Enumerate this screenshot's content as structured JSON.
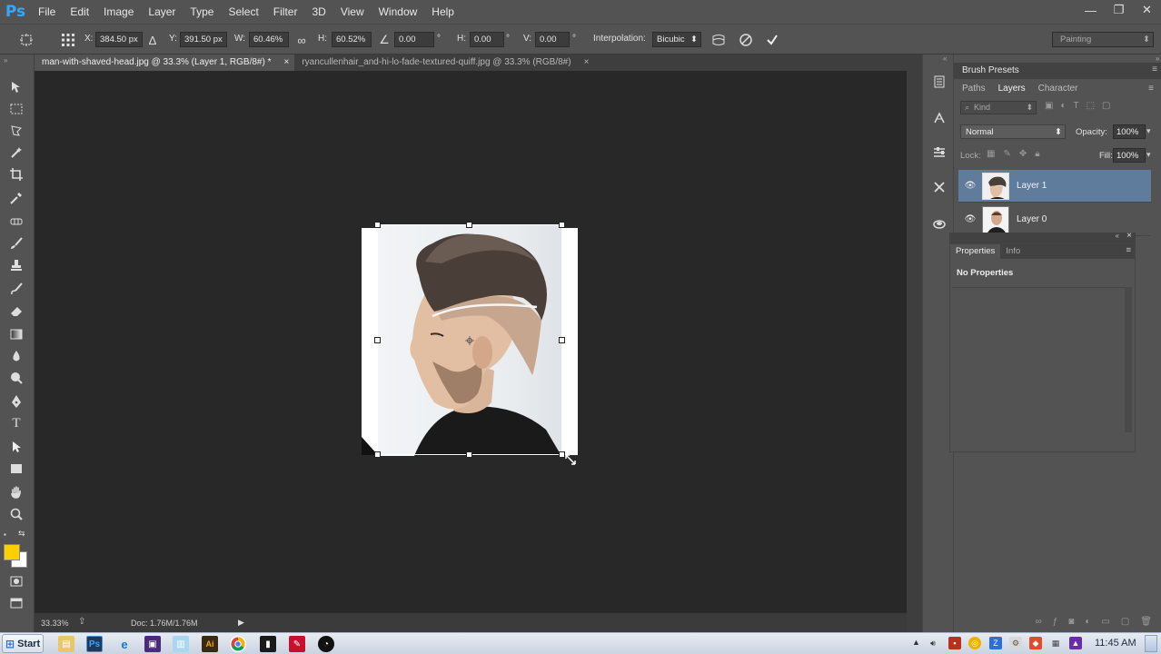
{
  "app": {
    "logo": "Ps"
  },
  "menu": [
    "File",
    "Edit",
    "Image",
    "Layer",
    "Type",
    "Select",
    "Filter",
    "3D",
    "View",
    "Window",
    "Help"
  ],
  "window_controls": {
    "minimize": "—",
    "restore": "❐",
    "close": "✕"
  },
  "options": {
    "x_label": "X:",
    "x_value": "384.50 px",
    "y_label": "Y:",
    "y_value": "391.50 px",
    "w_label": "W:",
    "w_value": "60.46%",
    "h_label": "H:",
    "h_value": "60.52%",
    "angle_value": "0.00",
    "hskew_label": "H:",
    "hskew_value": "0.00",
    "vskew_label": "V:",
    "vskew_value": "0.00",
    "degree": "°",
    "interp_label": "Interpolation:",
    "interp_value": "Bicubic",
    "workspace": "Painting"
  },
  "doc_tabs": [
    {
      "title": "man-with-shaved-head.jpg @ 33.3% (Layer 1, RGB/8#) *",
      "close": "×"
    },
    {
      "title": "ryancullenhair_and-hi-lo-fade-textured-quiff.jpg @ 33.3% (RGB/8#)",
      "close": "×"
    }
  ],
  "status": {
    "zoom": "33.33%",
    "doc": "Doc: 1.76M/1.76M"
  },
  "panels": {
    "brush_presets": "Brush Presets",
    "tabs": [
      "Paths",
      "Layers",
      "Character"
    ],
    "kind_label": "Kind",
    "blend_mode": "Normal",
    "opacity_label": "Opacity:",
    "opacity_value": "100%",
    "lock_label": "Lock:",
    "fill_label": "Fill:",
    "fill_value": "100%",
    "layers": [
      {
        "name": "Layer 1",
        "selected": true
      },
      {
        "name": "Layer 0",
        "selected": false
      }
    ],
    "props_tabs": [
      "Properties",
      "Info"
    ],
    "no_properties": "No Properties"
  },
  "taskbar": {
    "start": "Start",
    "time": "11:45 AM"
  },
  "colors": {
    "foreground": "#ffd000",
    "background": "#ffffff",
    "selected_layer": "#5f7c9c"
  }
}
